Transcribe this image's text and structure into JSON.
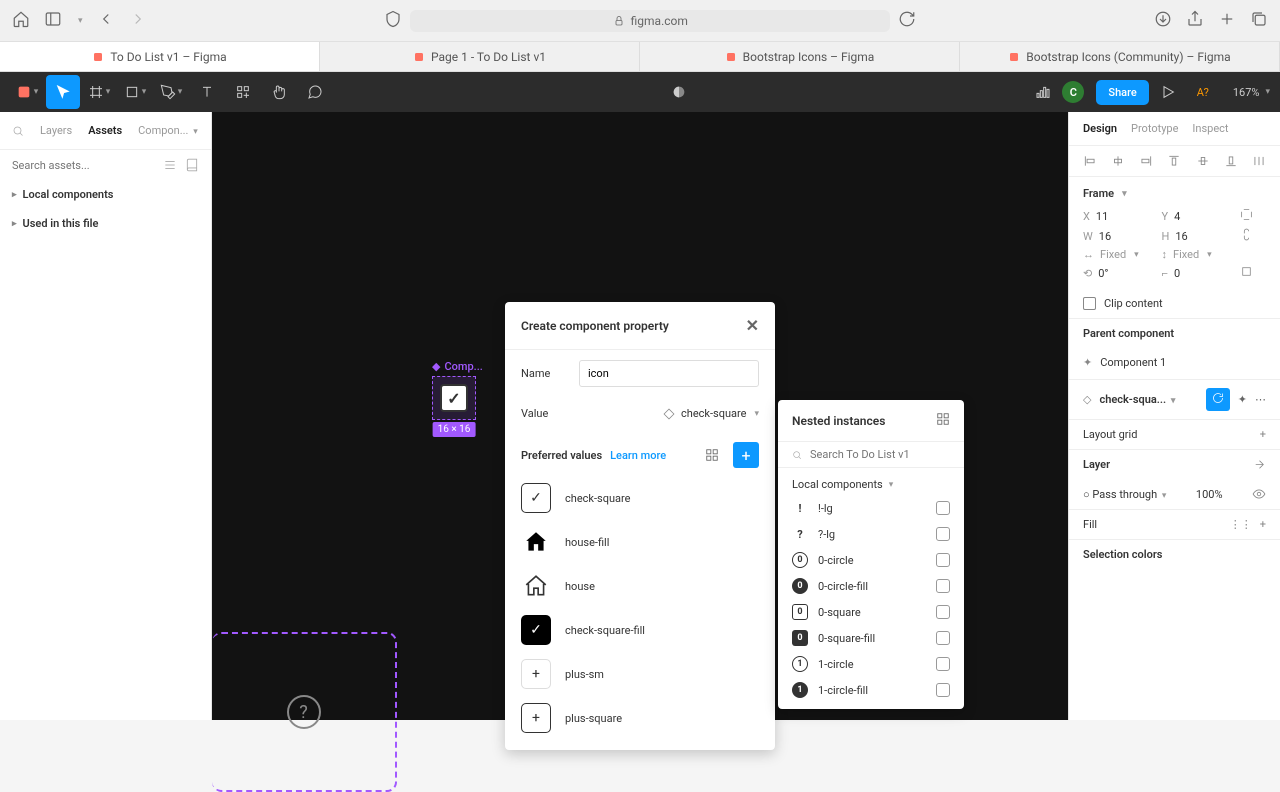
{
  "browser": {
    "url": "figma.com",
    "tabs": [
      "To Do List v1 – Figma",
      "Page 1 - To Do List v1",
      "Bootstrap Icons – Figma",
      "Bootstrap Icons (Community) – Figma"
    ]
  },
  "toolbar": {
    "avatar_initial": "C",
    "share_label": "Share",
    "view_label": "A?",
    "zoom_text": "167%"
  },
  "left": {
    "tab_layers": "Layers",
    "tab_assets": "Assets",
    "tab_compon": "Compon...",
    "search_placeholder": "Search assets...",
    "sec_local": "Local components",
    "sec_used": "Used in this file"
  },
  "canvas": {
    "label": "Comp...",
    "dims": "16 × 16"
  },
  "modal": {
    "title": "Create component property",
    "name_label": "Name",
    "name_value": "icon",
    "value_label": "Value",
    "value_selected": "check-square",
    "pref_title": "Preferred values",
    "learn_more": "Learn more",
    "items": [
      {
        "label": "check-square"
      },
      {
        "label": "house-fill"
      },
      {
        "label": "house"
      },
      {
        "label": "check-square-fill"
      },
      {
        "label": "plus-sm"
      },
      {
        "label": "plus-square"
      }
    ]
  },
  "nested": {
    "title": "Nested instances",
    "search_placeholder": "Search To Do List v1",
    "group": "Local components",
    "items": [
      {
        "label": "!-lg"
      },
      {
        "label": "?-lg"
      },
      {
        "label": "0-circle"
      },
      {
        "label": "0-circle-fill"
      },
      {
        "label": "0-square"
      },
      {
        "label": "0-square-fill"
      },
      {
        "label": "1-circle"
      },
      {
        "label": "1-circle-fill"
      }
    ]
  },
  "right": {
    "tab_design": "Design",
    "tab_proto": "Prototype",
    "tab_inspect": "Inspect",
    "frame_label": "Frame",
    "x_label": "X",
    "x_val": "11",
    "y_label": "Y",
    "y_val": "4",
    "w_label": "W",
    "w_val": "16",
    "h_label": "H",
    "h_val": "16",
    "fixed": "Fixed",
    "angle": "0°",
    "radius": "0",
    "clip": "Clip content",
    "parent_title": "Parent component",
    "parent_name": "Component 1",
    "instance_name": "check-squa...",
    "layout_grid": "Layout grid",
    "layer_label": "Layer",
    "blend": "Pass through",
    "opacity": "100%",
    "fill_label": "Fill",
    "selection_colors": "Selection colors"
  }
}
